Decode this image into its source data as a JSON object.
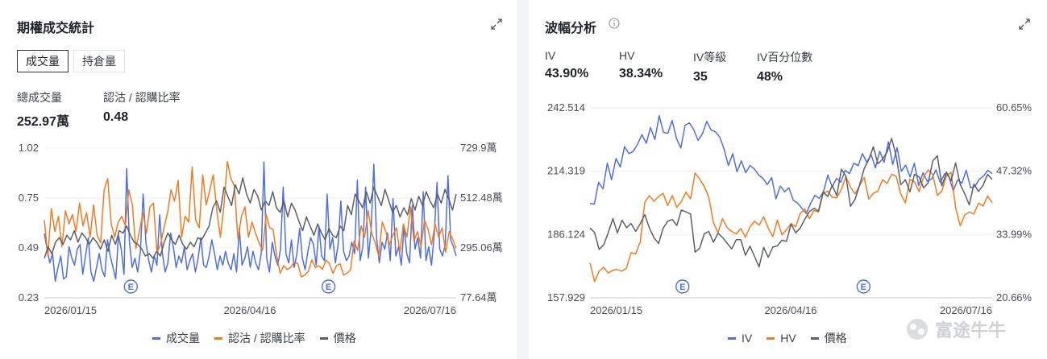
{
  "left_panel": {
    "title": "期權成交統計",
    "tabs": [
      {
        "label": "成交量",
        "active": true
      },
      {
        "label": "持倉量",
        "active": false
      }
    ],
    "stats": [
      {
        "label": "總成交量",
        "value": "252.97萬"
      },
      {
        "label": "認沽 / 認購比率",
        "value": "0.48"
      }
    ],
    "legend": [
      {
        "label": "成交量",
        "color": "#4f6fdf"
      },
      {
        "label": "認沽 / 認購比率",
        "color": "#f07b22"
      },
      {
        "label": "價格",
        "color": "#5b6068"
      }
    ],
    "event_marker": "E"
  },
  "right_panel": {
    "title": "波幅分析",
    "stats": [
      {
        "label": "IV",
        "value": "43.90%"
      },
      {
        "label": "HV",
        "value": "38.34%"
      },
      {
        "label": "IV等級",
        "value": "35"
      },
      {
        "label": "IV百分位數",
        "value": "48%"
      }
    ],
    "legend": [
      {
        "label": "IV",
        "color": "#4f6fdf"
      },
      {
        "label": "HV",
        "color": "#f07b22"
      },
      {
        "label": "價格",
        "color": "#5b6068"
      }
    ],
    "event_marker": "E"
  },
  "watermark": "富途牛牛",
  "chart_data": [
    {
      "type": "line",
      "x_tick_labels": [
        "2026/01/15",
        "2026/04/16",
        "2026/07/16"
      ],
      "y_left_ticks": [
        "1.02",
        "0.75",
        "0.49",
        "0.23"
      ],
      "y_left_range": [
        0.23,
        1.02
      ],
      "y_right_ticks": [
        "729.9萬",
        "512.48萬",
        "295.06萬",
        "77.64萬"
      ],
      "y_right_range": [
        776400,
        7299000
      ],
      "event_markers_at": [
        0.21,
        0.69
      ],
      "series": [
        {
          "name": "成交量",
          "axis": "right",
          "color": "#4f6fdf",
          "values": [
            3580000,
            2900000,
            2300000,
            2700000,
            1500000,
            2100000,
            2600000,
            1600000,
            1700000,
            3000000,
            2500000,
            2200000,
            2900000,
            3100000,
            1800000,
            2600000,
            3400000,
            1900000,
            1500000,
            2100000,
            2700000,
            2000000,
            1700000,
            3300000,
            2600000,
            2100000,
            1600000,
            3500000,
            2900000,
            1800000,
            6400000,
            3200000,
            2100000,
            2500000,
            1900000,
            2800000,
            5300000,
            3200000,
            2400000,
            1900000,
            2600000,
            2200000,
            4400000,
            2700000,
            1900000,
            2300000,
            3600000,
            3000000,
            2100000,
            2600000,
            2300000,
            3000000,
            2000000,
            2400000,
            2700000,
            1900000,
            2500000,
            3400000,
            2200000,
            2100000,
            2600000,
            3300000,
            2700000,
            2000000,
            2600000,
            2200000,
            2800000,
            2300000,
            2000000,
            2700000,
            1900000,
            3800000,
            2200000,
            2500000,
            3000000,
            2100000,
            2800000,
            2300000,
            2000000,
            2700000,
            6700000,
            2500000,
            1900000,
            3200000,
            2600000,
            2200000,
            2900000,
            5600000,
            2700000,
            2300000,
            3300000,
            2100000,
            2700000,
            3800000,
            2500000,
            2000000,
            2800000,
            3400000,
            3100000,
            2200000,
            3900000,
            2600000,
            2400000,
            5300000,
            2900000,
            3400000,
            2300000,
            3100000,
            5000000,
            2800000,
            2400000,
            2600000,
            3200000,
            2700000,
            5900000,
            2400000,
            3000000,
            5600000,
            2500000,
            3700000,
            6600000,
            3400000,
            2300000,
            3200000,
            2900000,
            3600000,
            2400000,
            5100000,
            2600000,
            3000000,
            2200000,
            3900000,
            2700000,
            2300000,
            4800000,
            2900000,
            3400000,
            2500000,
            5400000,
            2400000,
            3000000,
            2200000,
            3500000,
            5800000,
            2900000,
            2600000,
            3100000,
            6100000,
            3300000,
            3000000,
            2600000
          ]
        },
        {
          "name": "認沽 / 認購比率",
          "axis": "left",
          "color": "#f07b22",
          "values": [
            0.64,
            0.45,
            0.7,
            0.58,
            0.66,
            0.5,
            0.69,
            0.62,
            0.67,
            0.58,
            0.73,
            0.61,
            0.68,
            0.55,
            0.72,
            0.56,
            0.52,
            0.8,
            0.86,
            0.62,
            0.55,
            0.63,
            0.66,
            0.61,
            0.8,
            0.72,
            0.49,
            0.58,
            0.68,
            0.57,
            0.71,
            0.73,
            0.47,
            0.51,
            0.6,
            0.68,
            0.8,
            0.74,
            0.85,
            0.55,
            0.66,
            0.63,
            0.92,
            0.64,
            0.6,
            0.88,
            0.72,
            0.8,
            0.88,
            0.69,
            0.55,
            0.71,
            0.95,
            0.86,
            0.82,
            0.54,
            0.66,
            0.71,
            0.55,
            0.63,
            0.57,
            0.52,
            0.48,
            0.67,
            0.6,
            0.59,
            0.45,
            0.36,
            0.4,
            0.38,
            0.39,
            0.42,
            0.41,
            0.34,
            0.35,
            0.37,
            0.43,
            0.39,
            0.4,
            0.38,
            0.43,
            0.41,
            0.36,
            0.4,
            0.41,
            0.35,
            0.36,
            0.38,
            0.53,
            0.48,
            0.61,
            0.55,
            0.69,
            0.57,
            0.52,
            0.45,
            0.63,
            0.58,
            0.51,
            0.56,
            0.6,
            0.47,
            0.62,
            0.55,
            0.71,
            0.53,
            0.58,
            0.5,
            0.64,
            0.59,
            0.51,
            0.62,
            0.55,
            0.6,
            0.47,
            0.58,
            0.54,
            0.49
          ]
        },
        {
          "name": "價格",
          "axis": "right",
          "color": "#5b6068",
          "values": [
            2500000,
            3000000,
            2700000,
            3200000,
            3400000,
            3100000,
            3500000,
            3300000,
            3700000,
            3200000,
            3600000,
            3400000,
            3100000,
            3400000,
            3200000,
            2900000,
            3300000,
            2800000,
            3500000,
            3100000,
            3700000,
            3600000,
            3900000,
            3500000,
            3200000,
            3100000,
            2900000,
            2600000,
            2700000,
            2500000,
            2800000,
            2600000,
            3200000,
            3600000,
            3300000,
            3100000,
            3500000,
            3100000,
            2900000,
            3200000,
            3000000,
            3400000,
            3300000,
            3600000,
            3900000,
            4700000,
            5000000,
            4500000,
            5600000,
            5200000,
            4800000,
            5700000,
            5300000,
            6000000,
            5300000,
            4900000,
            5500000,
            5200000,
            4600000,
            5000000,
            4800000,
            5400000,
            4700000,
            4500000,
            5000000,
            4300000,
            4900000,
            4600000,
            4100000,
            3700000,
            4300000,
            3900000,
            3500000,
            4000000,
            3600000,
            3300000,
            3800000,
            3500000,
            3400000,
            3900000,
            3700000,
            4800000,
            4400000,
            5300000,
            5000000,
            4700000,
            5400000,
            4900000,
            5600000,
            5200000,
            4800000,
            5500000,
            5000000,
            4500000,
            4800000,
            4300000,
            4700000,
            4400000,
            5100000,
            4600000,
            5200000,
            4800000,
            5400000,
            5000000,
            4700000,
            5300000,
            4900000,
            5500000,
            5100000,
            4600000,
            5300000
          ]
        }
      ]
    },
    {
      "type": "line",
      "x_tick_labels": [
        "2026/01/15",
        "2026/04/16",
        "2026/07/16"
      ],
      "y_left_ticks": [
        "242.514",
        "214.319",
        "186.124",
        "157.929"
      ],
      "y_left_range": [
        157.929,
        242.514
      ],
      "y_right_ticks": [
        "60.65%",
        "47.32%",
        "33.99%",
        "20.66%"
      ],
      "y_right_range": [
        20.66,
        60.65
      ],
      "event_markers_at": [
        0.23,
        0.68
      ],
      "series": [
        {
          "name": "IV",
          "axis": "right",
          "color": "#4f6fdf",
          "values": [
            40.5,
            40.4,
            45.0,
            43.6,
            49.0,
            45.5,
            50.0,
            48.2,
            52.5,
            51.0,
            51.5,
            53.0,
            55.0,
            53.2,
            56.5,
            54.0,
            59.0,
            55.5,
            55.3,
            58.0,
            54.2,
            52.2,
            57.0,
            57.5,
            56.0,
            53.8,
            55.2,
            57.8,
            56.0,
            55.6,
            54.5,
            52.0,
            48.5,
            51.0,
            47.2,
            49.5,
            47.0,
            48.5,
            47.8,
            46.5,
            45.8,
            44.5,
            46.0,
            41.5,
            44.2,
            43.0,
            43.8,
            41.2,
            40.6,
            39.5,
            38.4,
            40.5,
            42.2,
            41.6,
            43.0,
            46.5,
            44.0,
            45.8,
            45.0,
            47.5,
            46.8,
            49.0,
            48.5,
            51.0,
            49.2,
            50.8,
            48.0,
            51.5,
            49.2,
            53.5,
            48.7,
            52.3,
            47.3,
            48.6,
            46.1,
            49.0,
            44.3,
            47.0,
            45.2,
            45.7,
            47.6,
            44.9,
            46.8,
            46.2,
            43.2,
            45.5,
            44.8,
            47.5,
            43.8,
            44.1,
            45.6,
            46.3,
            47.5,
            46.8
          ]
        },
        {
          "name": "HV",
          "axis": "left",
          "color": "#f07b22",
          "values": [
            173.5,
            165.2,
            169.8,
            171.5,
            169.0,
            170.2,
            170.5,
            169.8,
            171.2,
            178.0,
            177.5,
            183.0,
            200.5,
            203.4,
            201.0,
            203.0,
            204.5,
            199.0,
            203.5,
            198.2,
            200.8,
            205.0,
            202.0,
            213.5,
            210.8,
            207.5,
            202.7,
            191.5,
            186.9,
            193.2,
            189.1,
            187.5,
            186.4,
            188.8,
            185.0,
            189.5,
            192.0,
            190.3,
            194.0,
            189.0,
            185.2,
            192.5,
            186.0,
            188.3,
            191.0,
            189.5,
            195.5,
            197.5,
            193.2,
            196.8,
            196.2,
            204.3,
            205.5,
            202.7,
            202.5,
            206.2,
            211.9,
            207.2,
            204.2,
            208.0,
            211.5,
            201.9,
            204.5,
            205.5,
            210.5,
            208.9,
            213.0,
            212.0,
            204.2,
            200.2,
            210.7,
            209.6,
            205.2,
            211.8,
            214.8,
            212.8,
            203.5,
            205.5,
            212.4,
            213.8,
            198.1,
            190.0,
            194.8,
            196.1,
            195.2,
            200.1,
            198.8,
            203.2,
            200.2
          ]
        },
        {
          "name": "價格",
          "axis": "left",
          "color": "#5b6068",
          "values": [
            189.0,
            187.0,
            179.5,
            181.5,
            187.0,
            193.2,
            186.8,
            192.5,
            189.2,
            191.0,
            187.5,
            191.0,
            195.0,
            189.0,
            184.7,
            182.1,
            188.9,
            192.0,
            192.8,
            190.1,
            197.0,
            196.2,
            195.2,
            178.3,
            180.0,
            186.5,
            187.5,
            182.7,
            186.7,
            184.8,
            182.3,
            179.7,
            183.8,
            183.8,
            176.9,
            180.9,
            176.4,
            171.7,
            180.4,
            176.0,
            180.5,
            181.1,
            183.6,
            183.1,
            190.8,
            186.9,
            189.0,
            192.9,
            196.3,
            197.8,
            196.5,
            205.1,
            203.0,
            208.0,
            203.5,
            215.2,
            212.1,
            198.7,
            201.8,
            208.3,
            215.5,
            219.5,
            225.2,
            217.6,
            219.6,
            222.9,
            228.9,
            221.0,
            208.3,
            210.5,
            205.1,
            212.9,
            211.8,
            206.9,
            209.1,
            218.9,
            221.2,
            207.8,
            213.9,
            210.0,
            218.0,
            208.5,
            204.2,
            199.3,
            208.6,
            205.3,
            208.0,
            212.9,
            210.6
          ]
        }
      ]
    }
  ]
}
